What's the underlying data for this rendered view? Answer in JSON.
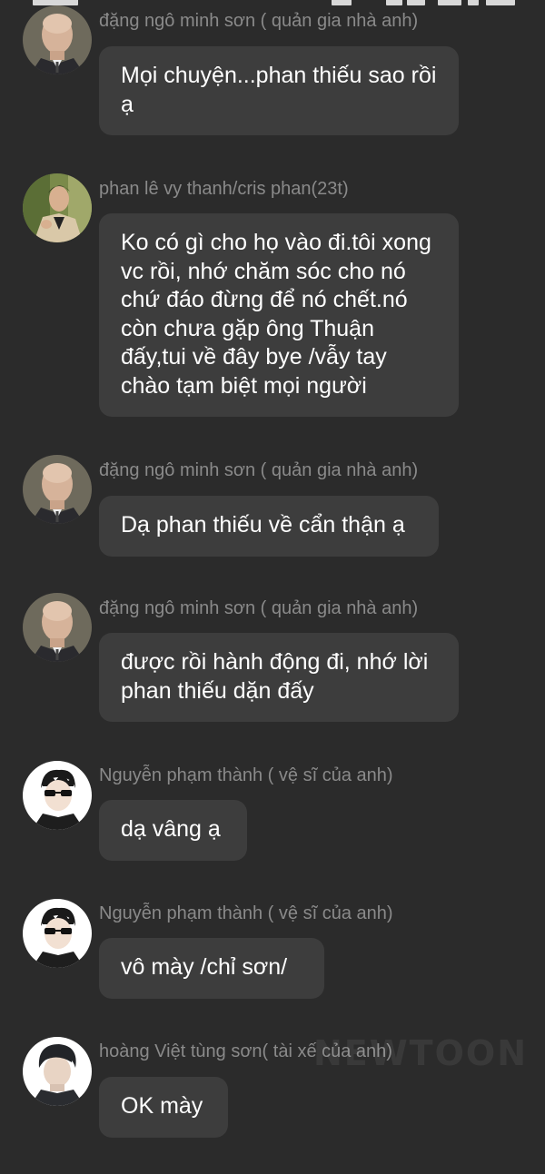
{
  "chat": {
    "messages": [
      {
        "sender": "đặng ngô minh sơn ( quản gia nhà anh)",
        "avatar_icon": "bald-man-avatar-icon",
        "text": "Mọi chuyện...phan thiếu sao rồi ạ"
      },
      {
        "sender": "phan lê vy thanh/cris phan(23t)",
        "avatar_icon": "young-man-avatar-icon",
        "text": "Ko có gì cho họ vào đi.tôi xong vc rồi, nhớ chăm sóc cho nó chứ đáo đừng để nó chết.nó còn chưa gặp ông Thuận đấy,tui về đây bye /vẫy tay chào tạm biệt mọi người"
      },
      {
        "sender": "đặng ngô minh sơn ( quản gia nhà anh)",
        "avatar_icon": "bald-man-avatar-icon",
        "text": "Dạ phan thiếu về cẩn thận ạ"
      },
      {
        "sender": "đặng ngô minh sơn ( quản gia nhà anh)",
        "avatar_icon": "bald-man-avatar-icon",
        "text": "được rồi hành động đi, nhớ lời phan thiếu dặn đấy"
      },
      {
        "sender": "Nguyễn phạm thành ( vệ sĩ của anh)",
        "avatar_icon": "sunglasses-man-avatar-icon",
        "text": "dạ vâng ạ"
      },
      {
        "sender": "Nguyễn phạm thành ( vệ sĩ của anh)",
        "avatar_icon": "sunglasses-man-avatar-icon",
        "text": "vô mày /chỉ sơn/"
      },
      {
        "sender": "hoàng Việt tùng sơn( tài xế của anh)",
        "avatar_icon": "dark-hair-man-avatar-icon",
        "text": "OK mày"
      }
    ]
  },
  "watermark": "NEWTOON"
}
